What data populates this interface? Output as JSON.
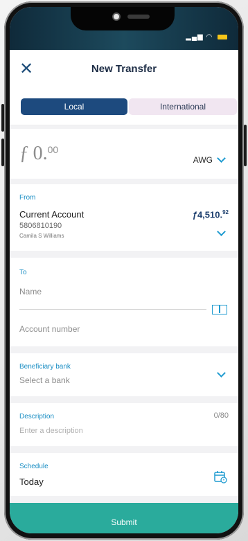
{
  "header": {
    "title": "New Transfer"
  },
  "tabs": {
    "local_label": "Local",
    "international_label": "International"
  },
  "amount": {
    "symbol": "ƒ",
    "value": "0.",
    "decimals": "00",
    "currency": "AWG"
  },
  "from": {
    "label": "From",
    "account_name": "Current Account",
    "account_number": "5806810190",
    "owner": "Camila S Williams",
    "balance_main": "ƒ4,510.",
    "balance_cents": "92"
  },
  "to": {
    "label": "To",
    "name_placeholder": "Name",
    "account_placeholder": "Account number"
  },
  "bank": {
    "label": "Beneficiary bank",
    "placeholder": "Select a bank"
  },
  "description": {
    "label": "Description",
    "counter": "0/80",
    "placeholder": "Enter a description"
  },
  "schedule": {
    "label": "Schedule",
    "value": "Today"
  },
  "submit_label": "Submit",
  "colors": {
    "primary": "#1d4a7e",
    "accent": "#1f9bd0",
    "submit": "#2aab9c"
  },
  "icons": [
    "close-icon",
    "chevron-down-icon",
    "address-book-icon",
    "calendar-icon",
    "signal-icon",
    "wifi-icon",
    "battery-icon"
  ]
}
